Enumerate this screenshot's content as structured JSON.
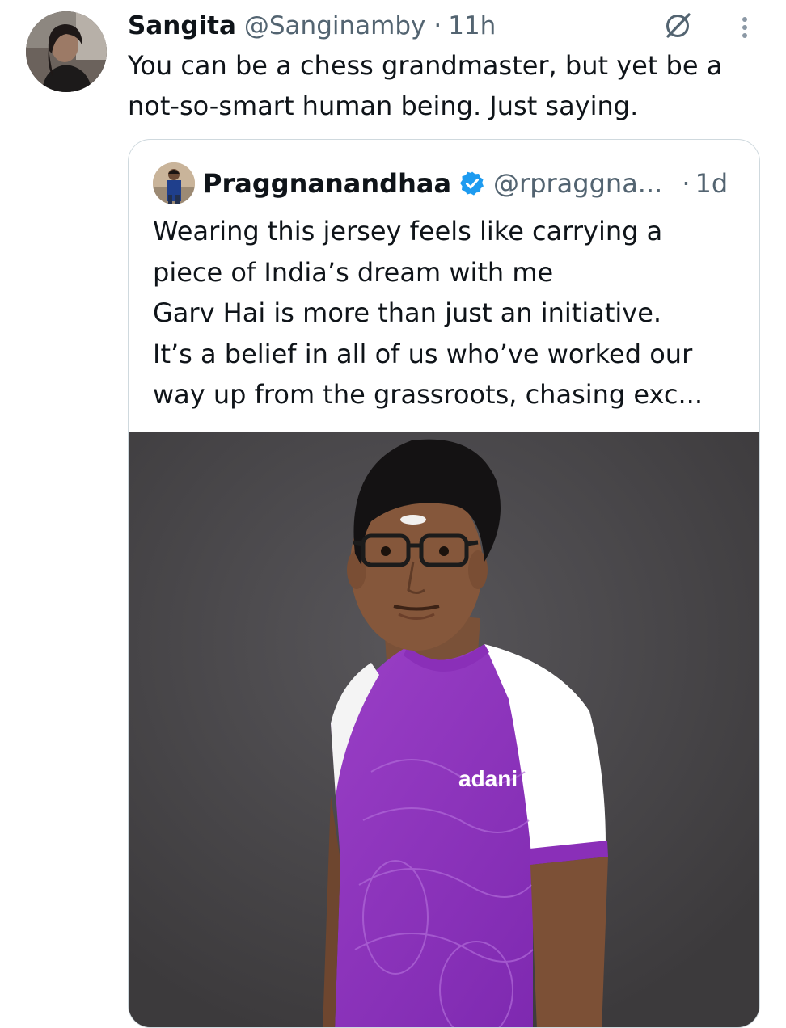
{
  "tweet": {
    "author_name": "Sangita",
    "handle": "@Sanginamby",
    "separator": "·",
    "time": "11h",
    "text": "You can be a chess grandmaster, but yet be a not-so-smart human being. Just saying."
  },
  "icons": {
    "grok": "grok-icon",
    "more": "more-vertical-icon",
    "verified": "verified-badge-icon"
  },
  "quoted_tweet": {
    "author_name": "Praggnanandhaa",
    "handle": "@rpraggna...",
    "separator": "·",
    "time": "1d",
    "text": "Wearing this jersey feels like carrying a\npiece of India’s dream with me\nGarv Hai is more than just an initiative.\nIt’s a belief in all of us who’ve worked our\nway up from the grassroots, chasing exc..."
  },
  "media": {
    "jersey_logo_text": "adani"
  },
  "colors": {
    "text_primary": "#0f1419",
    "text_secondary": "#536471",
    "border": "#cfd9de",
    "verified_blue": "#1d9bf0",
    "jersey_purple": "#8a2fb8"
  }
}
